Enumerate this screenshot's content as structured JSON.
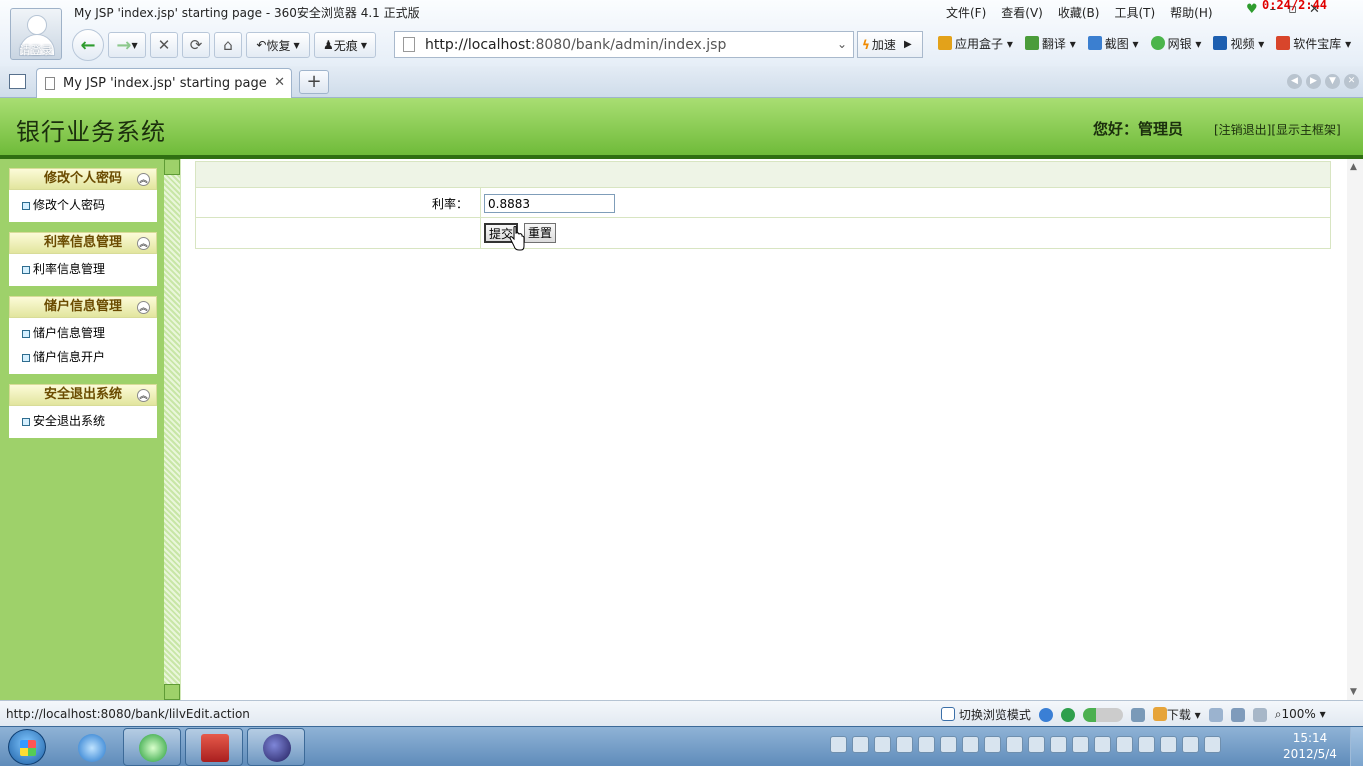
{
  "browser": {
    "window_title": "My JSP 'index.jsp' starting page - 360安全浏览器 4.1 正式版",
    "avatar_label": "请登录",
    "timer": "0:24/2:44",
    "menu": [
      "文件(F)",
      "查看(V)",
      "收藏(B)",
      "工具(T)",
      "帮助(H)"
    ],
    "restore_label": "恢复",
    "traceless_label": "无痕",
    "url_host": "http://localhost",
    "url_path": ":8080/bank/admin/index.jsp",
    "speed_label": "加速",
    "extensions": [
      "应用盒子",
      "翻译",
      "截图",
      "网银",
      "视频",
      "软件宝库"
    ],
    "tab_title": "My JSP 'index.jsp' starting page",
    "status_url": "http://localhost:8080/bank/lilvEdit.action",
    "mode_label": "切换浏览模式",
    "download_label": "下载",
    "zoom": "100%"
  },
  "app": {
    "title": "银行业务系统",
    "greeting": "您好：管理员",
    "logout_link": "[注销退出]",
    "show_frame_link": "[显示主框架]"
  },
  "sidebar": {
    "groups": [
      {
        "title": "修改个人密码",
        "items": [
          "修改个人密码"
        ]
      },
      {
        "title": "利率信息管理",
        "items": [
          "利率信息管理"
        ]
      },
      {
        "title": "储户信息管理",
        "items": [
          "储户信息管理",
          "储户信息开户"
        ]
      },
      {
        "title": "安全退出系统",
        "items": [
          "安全退出系统"
        ]
      }
    ]
  },
  "form": {
    "rate_label": "利率：",
    "rate_value": "0.8883",
    "submit_label": "提交",
    "reset_label": "重置"
  },
  "taskbar": {
    "time": "15:14",
    "date": "2012/5/4"
  }
}
